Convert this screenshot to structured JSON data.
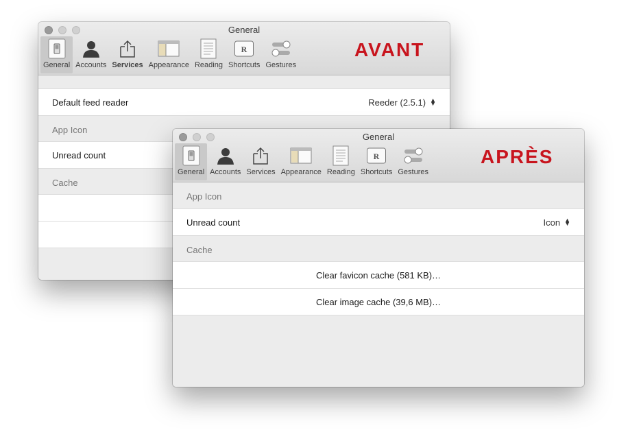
{
  "before": {
    "window_title": "General",
    "badge": "AVANT",
    "toolbar": [
      {
        "label": "General",
        "icon": "switch-icon",
        "selected": true,
        "bold": false
      },
      {
        "label": "Accounts",
        "icon": "person-icon",
        "selected": false,
        "bold": false
      },
      {
        "label": "Services",
        "icon": "share-icon",
        "selected": false,
        "bold": true
      },
      {
        "label": "Appearance",
        "icon": "window-layout-icon",
        "selected": false,
        "bold": false
      },
      {
        "label": "Reading",
        "icon": "document-icon",
        "selected": false,
        "bold": false
      },
      {
        "label": "Shortcuts",
        "icon": "key-r-icon",
        "selected": false,
        "bold": false
      },
      {
        "label": "Gestures",
        "icon": "toggle-icon",
        "selected": false,
        "bold": false
      }
    ],
    "feed_reader": {
      "label": "Default feed reader",
      "value": "Reeder (2.5.1)"
    },
    "app_icon": {
      "section": "App Icon",
      "unread_label": "Unread count"
    },
    "cache": {
      "section": "Cache"
    }
  },
  "after": {
    "window_title": "General",
    "badge": "APRÈS",
    "toolbar": [
      {
        "label": "General",
        "icon": "switch-icon",
        "selected": true
      },
      {
        "label": "Accounts",
        "icon": "person-icon",
        "selected": false
      },
      {
        "label": "Services",
        "icon": "share-icon",
        "selected": false
      },
      {
        "label": "Appearance",
        "icon": "window-layout-icon",
        "selected": false
      },
      {
        "label": "Reading",
        "icon": "document-icon",
        "selected": false
      },
      {
        "label": "Shortcuts",
        "icon": "key-r-icon",
        "selected": false
      },
      {
        "label": "Gestures",
        "icon": "toggle-icon",
        "selected": false
      }
    ],
    "app_icon": {
      "section": "App Icon",
      "unread_label": "Unread count",
      "unread_value": "Icon"
    },
    "cache": {
      "section": "Cache",
      "clear_favicon": "Clear favicon cache (581 KB)…",
      "clear_images": "Clear image cache (39,6 MB)…"
    }
  },
  "icons": {
    "shortcut_key_letter": "R"
  },
  "colors": {
    "badge": "#c8141d",
    "window_bg": "#ececec",
    "selected_tool": "#c9c9c9"
  }
}
